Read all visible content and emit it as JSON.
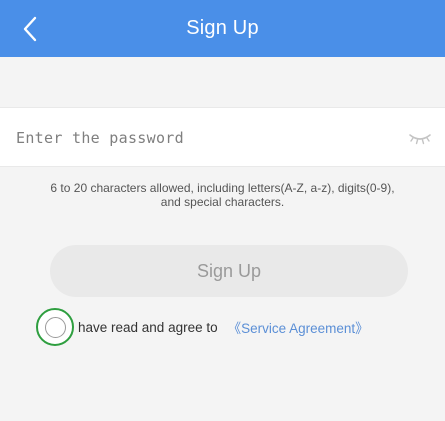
{
  "header": {
    "title": "Sign Up",
    "back_icon": "chevron-left-icon",
    "background_color": "#4a8fe8"
  },
  "password": {
    "placeholder": "Enter the password",
    "value": "",
    "toggle_icon": "eye-closed-icon"
  },
  "hint": "6 to 20 characters allowed, including letters(A-Z, a-z), digits(0-9), and special characters.",
  "signup_button": {
    "label": "Sign Up",
    "enabled": false
  },
  "agreement": {
    "text": "have read and agree to",
    "link": "《Service Agreement》",
    "checked": false,
    "focus_ring_color": "#2e9e3f"
  }
}
